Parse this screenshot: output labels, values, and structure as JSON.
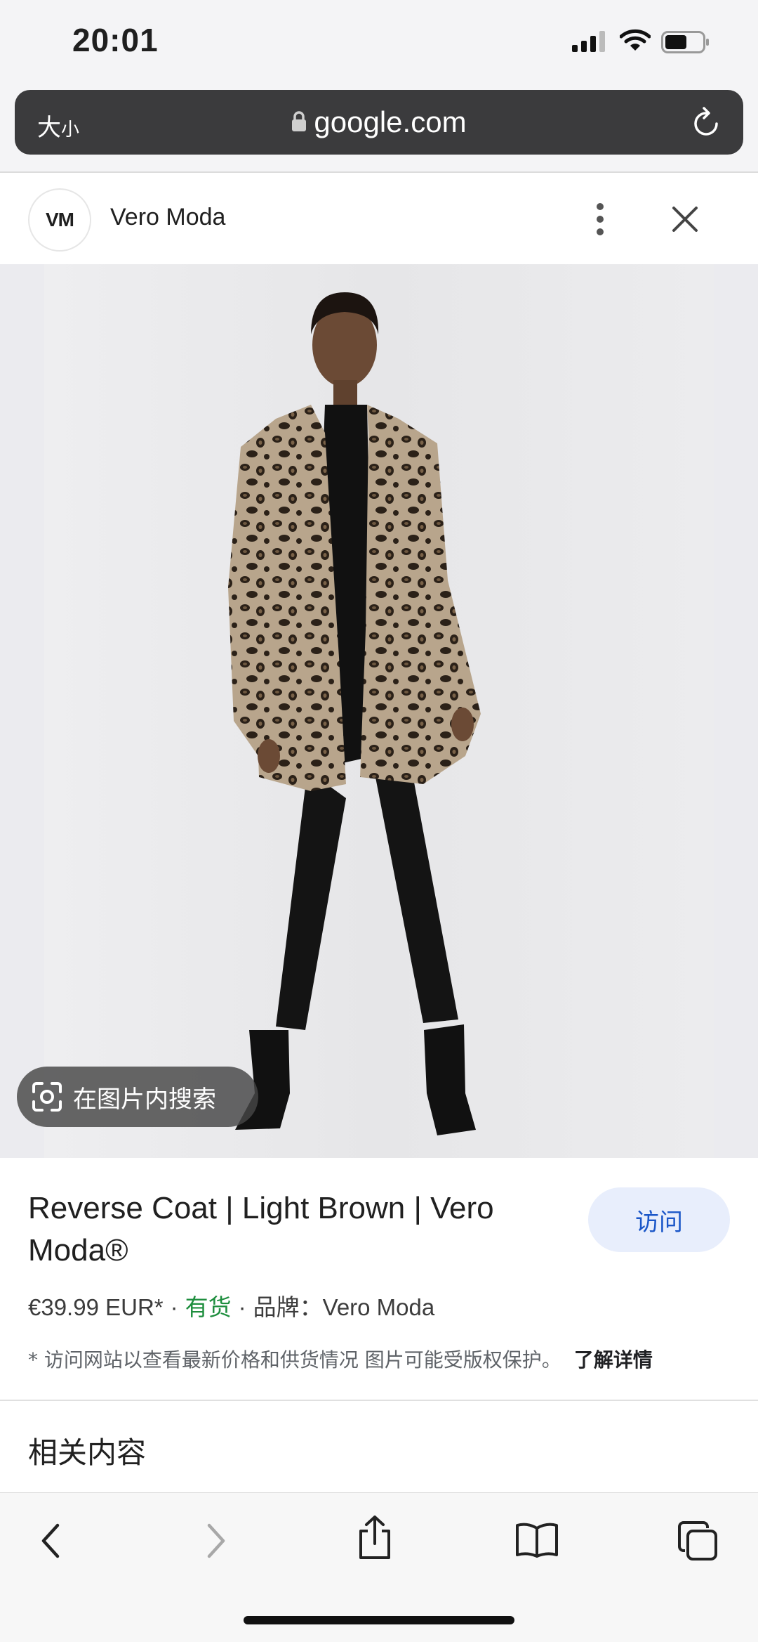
{
  "status_bar": {
    "time": "20:01"
  },
  "address_bar": {
    "text_size": "大",
    "text_size_small": "小",
    "url": "google.com"
  },
  "site": {
    "logo": "VM",
    "name": "Vero Moda"
  },
  "image": {
    "lens_label": "在图片内搜索"
  },
  "product": {
    "title": "Reverse Coat | Light Brown | Vero Moda®",
    "visit_label": "访问",
    "price": "€39.99 EUR*",
    "stock": "有货",
    "brand_label": "品牌：",
    "brand": "Vero Moda",
    "sep": "·",
    "note": "* 访问网站以查看最新价格和供货情况 图片可能受版权保护。",
    "learn_more": "了解详情"
  },
  "related": {
    "heading": "相关内容"
  },
  "icons": [
    "signal-icon",
    "wifi-icon",
    "battery-icon",
    "lock-icon",
    "reload-icon",
    "more-icon",
    "close-icon",
    "lens-icon",
    "back-icon",
    "forward-icon",
    "share-icon",
    "bookmarks-icon",
    "tabs-icon"
  ],
  "colors": {
    "accent": "#1a56c8",
    "in_stock": "#1e8e3e",
    "address_bar": "#3b3b3d"
  }
}
